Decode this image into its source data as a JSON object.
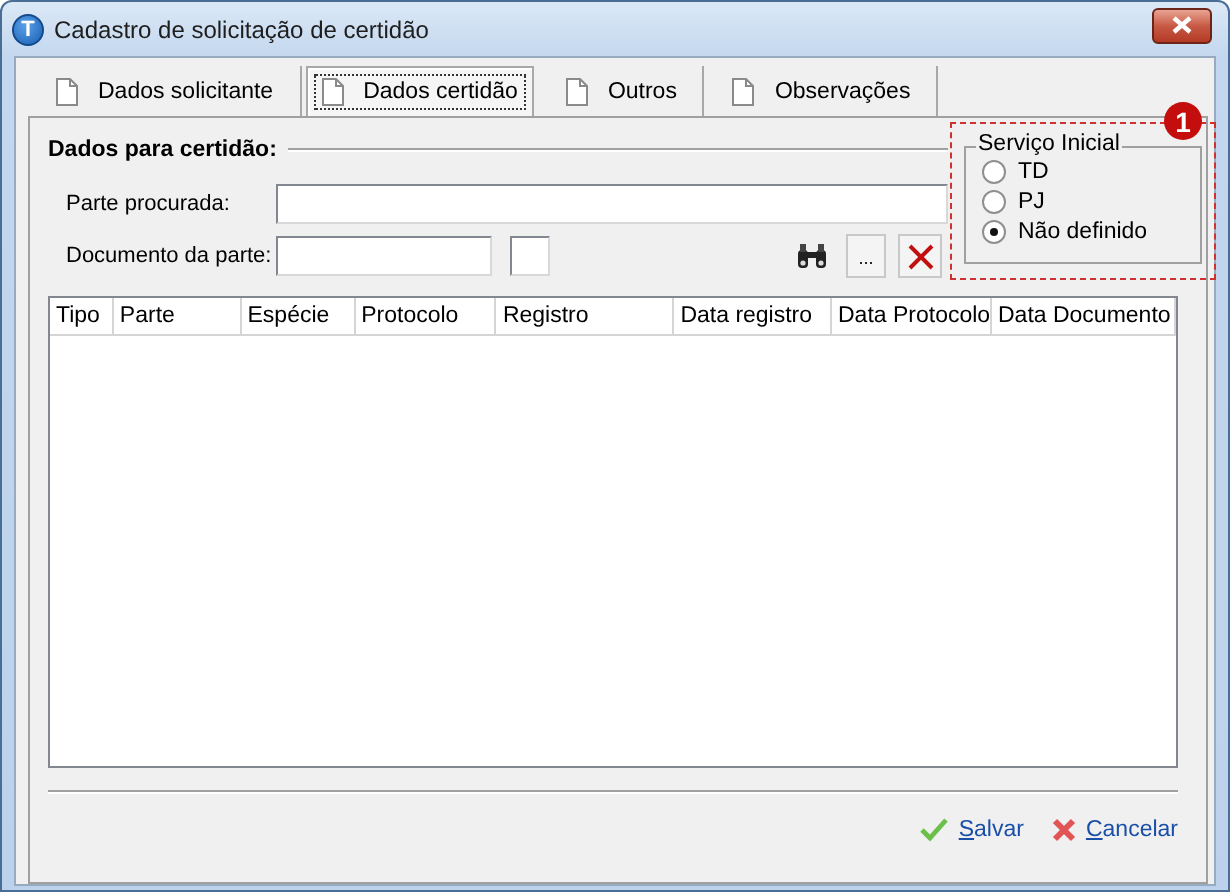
{
  "window": {
    "title": "Cadastro de solicitação de certidão",
    "icon_letter": "T"
  },
  "tabs": [
    {
      "label": "Dados solicitante",
      "selected": false
    },
    {
      "label": "Dados certidão",
      "selected": true
    },
    {
      "label": "Outros",
      "selected": false
    },
    {
      "label": "Observações",
      "selected": false
    }
  ],
  "section": {
    "title": "Dados para certidão:"
  },
  "fields": [
    {
      "label": "Parte procurada:",
      "kind": "wide"
    },
    {
      "label": "Documento da parte:",
      "kind": "split"
    }
  ],
  "tools": [
    {
      "kind": "search"
    },
    {
      "kind": "more",
      "label": "..."
    },
    {
      "kind": "clear"
    }
  ],
  "service_group": {
    "title": "Serviço Inicial",
    "annotation": "1",
    "options": [
      {
        "label": "TD",
        "selected": false
      },
      {
        "label": "PJ",
        "selected": false
      },
      {
        "label": "Não definido",
        "selected": true
      }
    ]
  },
  "table": {
    "columns": [
      "Tipo",
      "Parte",
      "Espécie",
      "Protocolo",
      "Registro",
      "Data registro",
      "Data Protocolo",
      "Data Documento"
    ]
  },
  "actions": [
    {
      "kind": "save",
      "label": "Salvar"
    },
    {
      "kind": "cancel",
      "label": "Cancelar"
    }
  ]
}
